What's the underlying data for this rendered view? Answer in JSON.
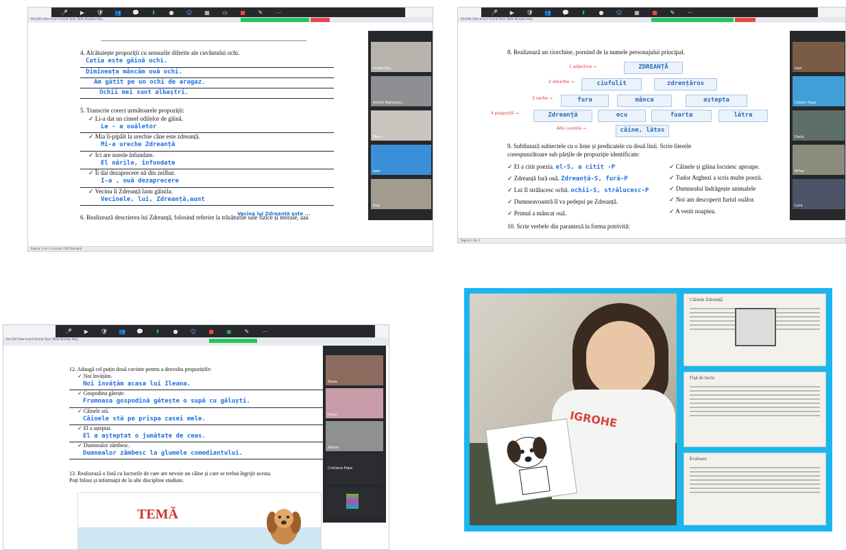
{
  "toolbar": {
    "items": [
      "Mute",
      "Video",
      "Security",
      "Participants",
      "Chat",
      "Share",
      "Record",
      "Reactions",
      "Apps",
      "Whiteboard",
      "More"
    ],
    "status_green": "You are viewing screen share",
    "status_red": "Stop Share",
    "row": "File  Edit  View  Insert  Format  Tools  Table  Window  Help"
  },
  "panel1": {
    "ex4_title": "4. Alcătuiește propoziții cu sensurile diferite ale cuvântului ochi.",
    "ex4_answers": [
      "Catia este găină ochi.",
      "Dimineața mâncăm ouă ochi.",
      "Am gătit pe un ochi de aragaz.",
      "Ochii mei sunt albaștri."
    ],
    "ex5_title": "5. Transcrie corect următoarele propoziții:",
    "ex5_items": [
      {
        "check": "Li-a dat un cineel odilelor de găină.",
        "answer": "Le - a    ouăletor"
      },
      {
        "check": "Mia îi-pipăit la urechie câne este zdreanță.",
        "answer": "Mi-a  ureche Zdreanță"
      },
      {
        "check": "Ici are norele înfundate.",
        "answer": "El  nările, înfundate"
      },
      {
        "check": "Îi dai dezaprecere nă din zeilbar.",
        "answer": "I-a , ouă    dezaprecere"
      },
      {
        "check": "Vecinu îi Zdreanță îanu găinila.",
        "answer": "Vecinele, lui, Zdreanță,aunt"
      }
    ],
    "extra_answer": "Vecina lui Zdreanță este ...",
    "ex6": "6. Realizează descrierea lui Zdreanță, folosind referire la trăsăturile sale fizice și morale, aaa",
    "status": "Pagina 1 din 3   Cuvinte 2342   Română",
    "participants": [
      {
        "name": "Ionela Pop"
      },
      {
        "name": "Andrei Marinescu"
      },
      {
        "name": "Maria"
      },
      {
        "name": "Sebi"
      },
      {
        "name": "Ana"
      }
    ]
  },
  "panel2": {
    "ex8_title": "8. Realizează un ciorchine, pornind de la numele personajului principal.",
    "center": "ZDREANȚĂ",
    "label1": "1 adjective →",
    "label2": "2 adverbe →",
    "label3": "3 verbe →",
    "label4": "4 propoziții →",
    "label5": "Alte cuvinte →",
    "row1": [
      "ciufulit",
      "zdrențăros"
    ],
    "row2": [
      "fura",
      "mânca",
      "aștepta"
    ],
    "row3": [
      "Zdreanță",
      "ecu",
      "fuarta",
      "lătra"
    ],
    "row4": [
      "câine, lătos"
    ],
    "ex9_title": "9. Subliniază subiectele cu o linie și predicatele cu două linii. Scrie literele",
    "ex9_sub": "corespunzătoare sub părțile de propoziție identificate:",
    "left": [
      {
        "text": "El a citit poezia.",
        "ans": "el-S, a citit -P"
      },
      {
        "text": "Zdreanță fură ouă.",
        "ans": "Zdreanță-S, fură-P"
      },
      {
        "text": "Lui Il strălucesc ochii.",
        "ans": "ochii-S, strălucesc-P"
      },
      {
        "text": "Dumneavoastră îl va pedepsi pe Zdreanță.",
        "ans": ""
      },
      {
        "text": "Primul a mâncat ouă.",
        "ans": ""
      }
    ],
    "right": [
      "Câinele și găina locuiesc aproape.",
      "Tudor Arghezi a scris multe poezii.",
      "Dumnealui îndrăgește animalele",
      "Noi am descoperit furtul ouălor.",
      "A venit noaptea."
    ],
    "sp_letters": [
      "SP",
      "S",
      "P",
      "S",
      "P"
    ],
    "ex10": "10. Scrie verbele din paranteză la forma potrivită:",
    "participants": [
      {
        "name": "Ioan"
      },
      {
        "name": "Catalin Popa"
      },
      {
        "name": "Daria"
      },
      {
        "name": "Mihai"
      },
      {
        "name": "Luca"
      }
    ],
    "status": "Pagina 2 din 3"
  },
  "panel3": {
    "ex12_title": "12. Adaugă cel puțin două cuvinte pentru a dezvolta propozițiile:",
    "items": [
      {
        "check": "Noi învățăm.",
        "answer": "Noi învățăm acasa lui Ileana."
      },
      {
        "check": "Gospodina gătește.",
        "answer": "Frumoasa gospodină gătește o supă cu găluști."
      },
      {
        "check": "Câinele stă.",
        "answer": "Câinele stă pe prispa casei mele."
      },
      {
        "check": "El a așteptat.",
        "answer": "El a așteptat o jumătate de ceas."
      },
      {
        "check": "Dumnealor zâmbesc.",
        "answer": "Dumnealor zâmbesc la glumele comediantului."
      }
    ],
    "ex13_title": "13. Realizează o listă cu lucrurile de care are nevoie un câine și care se trebui îngrijit acesta.",
    "ex13_sub": "Poți folosi și informații de la alte discipline studiate.",
    "tema": "TEMĂ",
    "participants": [
      {
        "name": "Elena"
      },
      {
        "name": "Ilinca"
      },
      {
        "name": "Adrian"
      },
      {
        "name": "Cristiana Popa"
      },
      {
        "name": ""
      }
    ]
  },
  "panel4": {
    "shirt_text": "IGROHE",
    "sheet1_title": "Câinele Zdreanță",
    "sheet2_title": "Fișă de lucru",
    "sheet3_title": "Evaluare"
  }
}
